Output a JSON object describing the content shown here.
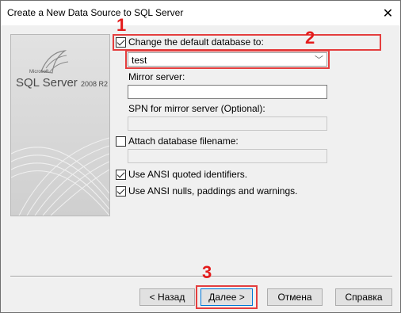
{
  "window": {
    "title": "Create a New Data Source to SQL Server",
    "close_glyph": "✕"
  },
  "logo": {
    "brand_small": "Microsoft",
    "product": "SQL Server",
    "version": "2008 R2"
  },
  "form": {
    "change_db": {
      "label": "Change the default database to:",
      "checked": true
    },
    "database": {
      "value": "test"
    },
    "mirror_server": {
      "label": "Mirror server:",
      "value": ""
    },
    "spn": {
      "label": "SPN for mirror server (Optional):",
      "value": ""
    },
    "attach_db": {
      "label": "Attach database filename:",
      "checked": false,
      "value": ""
    },
    "ansi_quoted": {
      "label": "Use ANSI quoted identifiers.",
      "checked": true
    },
    "ansi_nulls": {
      "label": "Use ANSI nulls, paddings and warnings.",
      "checked": true
    }
  },
  "buttons": {
    "back": "< Назад",
    "next": "Далее >",
    "cancel": "Отмена",
    "help": "Справка"
  },
  "annotations": {
    "n1": "1",
    "n2": "2",
    "n3": "3",
    "color": "#e43e3e"
  }
}
